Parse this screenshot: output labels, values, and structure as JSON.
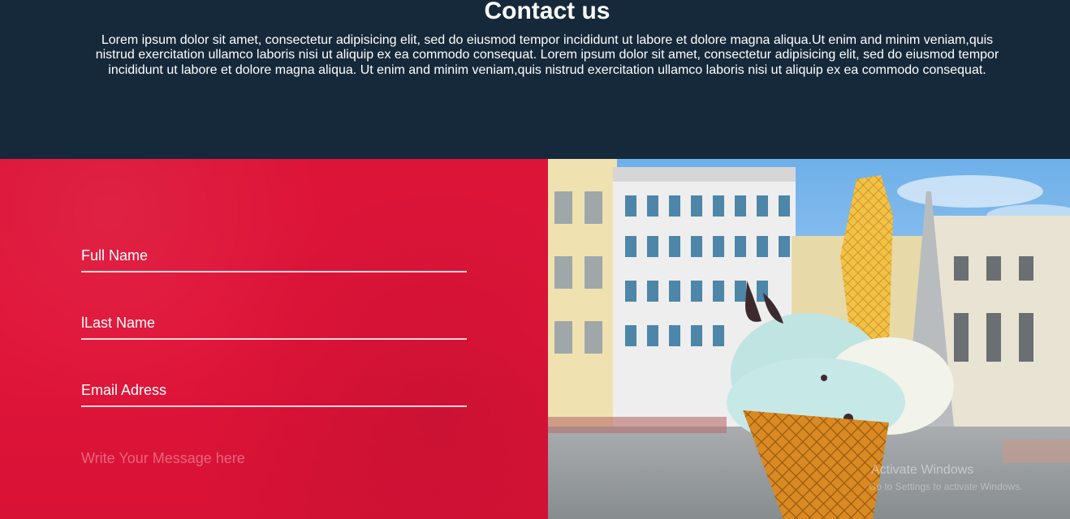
{
  "header": {
    "title": "Contact us",
    "description": "Lorem ipsum dolor sit amet, consectetur adipisicing elit, sed do eiusmod tempor incididunt ut labore et dolore magna aliqua.Ut enim and minim veniam,quis nistrud exercitation ullamco laboris nisi ut aliquip ex ea commodo consequat. Lorem ipsum dolor sit amet, consectetur adipisicing elit, sed do eiusmod tempor incididunt ut labore et dolore magna aliqua. Ut enim and minim veniam,quis nistrud exercitation ullamco laboris nisi ut aliquip ex ea commodo consequat."
  },
  "form": {
    "full_name_label": "Full Name",
    "last_name_label": "lLast Name",
    "email_label": "Email Adress",
    "message_placeholder": "Write Your Message here"
  },
  "watermark": {
    "line1": "Activate Windows",
    "line2": "Go to Settings to activate Windows."
  },
  "colors": {
    "header_bg": "#15293a",
    "form_bg": "#dc1438",
    "text": "#ffffff"
  }
}
